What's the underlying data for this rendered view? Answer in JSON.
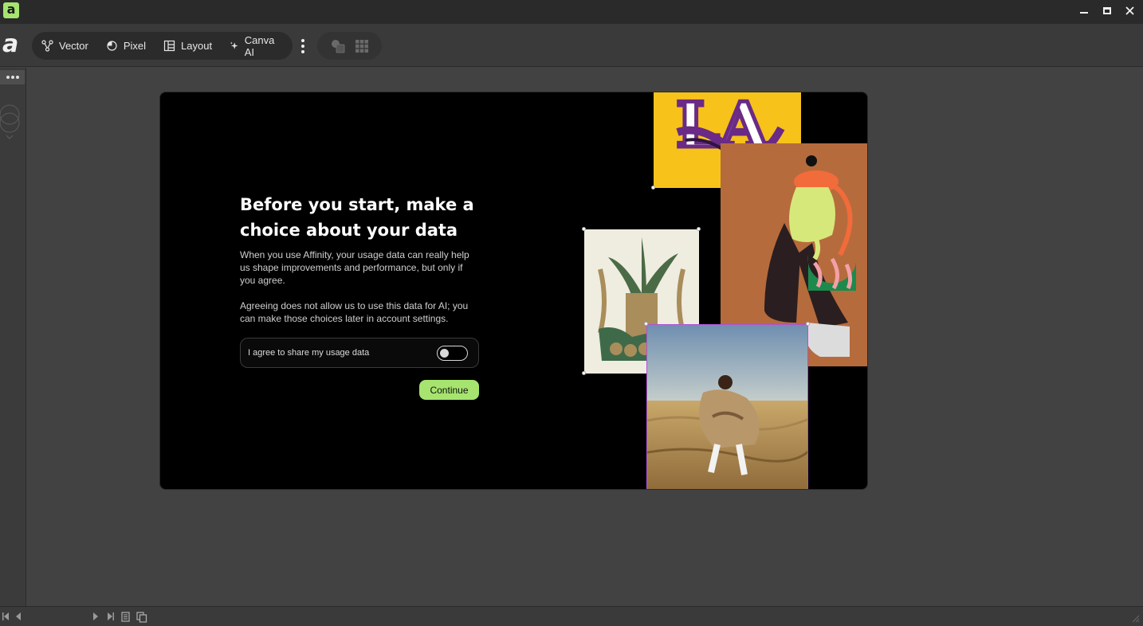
{
  "window": {
    "logo_letter": "a",
    "controls": {
      "minimize": "minimize-icon",
      "maximize": "maximize-icon",
      "close": "close-icon"
    }
  },
  "toolbar": {
    "brand_letter": "a",
    "personas": [
      {
        "label": "Vector",
        "icon": "vector-icon"
      },
      {
        "label": "Pixel",
        "icon": "pixel-icon"
      },
      {
        "label": "Layout",
        "icon": "layout-icon"
      },
      {
        "label": "Canva AI",
        "icon": "sparkle-icon"
      }
    ],
    "more_icon": "more-vertical-icon",
    "tools": [
      "assets-icon",
      "grid-icon"
    ]
  },
  "dialog": {
    "heading": "Before you start, make a choice about your data",
    "paragraph1": "When you use Affinity, your usage data can really help us shape improvements and performance, but only if you agree.",
    "paragraph2": "Agreeing does not allow us to use this data for AI; you can make those choices later in account settings.",
    "consent_label": "I agree to share my usage data",
    "consent_enabled": false,
    "continue_label": "Continue",
    "accent_color": "#a6e46f"
  },
  "artwork": {
    "yellow_poster_text": "LA",
    "colors": {
      "yellow": "#f7c21a",
      "orange": "#b66b3d",
      "cream": "#efece0",
      "selection": "#b052d8"
    }
  },
  "bottombar": {
    "buttons": [
      "first-page-icon",
      "prev-page-icon",
      "next-page-icon",
      "last-page-icon",
      "page-icon",
      "pages-icon"
    ]
  }
}
